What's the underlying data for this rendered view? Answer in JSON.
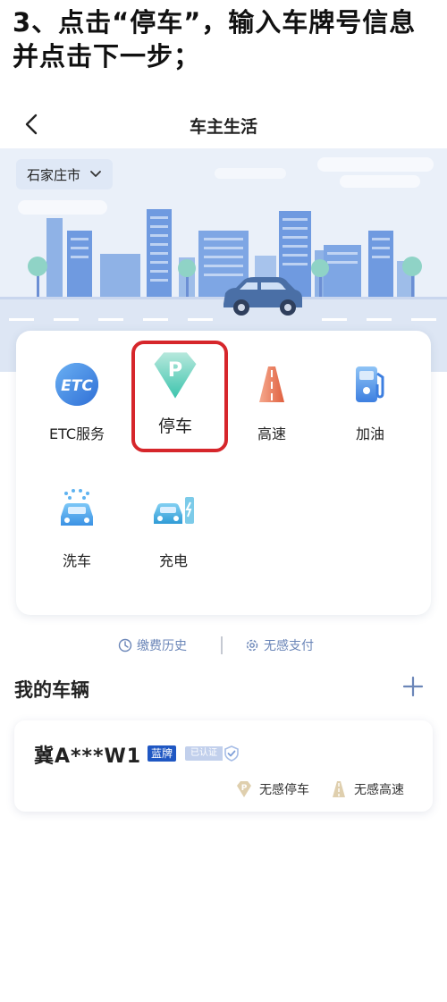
{
  "instruction": {
    "line1": "3、点击“停车”，输入车牌号信息",
    "line2": "并点击下一步；"
  },
  "nav": {
    "title": "车主生活",
    "back_icon": "chevron-left-icon"
  },
  "city": {
    "name": "石家庄市",
    "icon": "chevron-down-icon"
  },
  "services": [
    {
      "label": "ETC服务",
      "icon": "etc-icon"
    },
    {
      "label": "停车",
      "icon": "parking-icon",
      "highlighted": true
    },
    {
      "label": "高速",
      "icon": "highway-icon"
    },
    {
      "label": "加油",
      "icon": "fuel-icon"
    },
    {
      "label": "洗车",
      "icon": "car-wash-icon"
    },
    {
      "label": "充电",
      "icon": "charging-icon"
    }
  ],
  "links": {
    "history": "缴费历史",
    "pay": "无感支付"
  },
  "vehicles_title": "我的车辆",
  "vehicle": {
    "plate": "冀A***W1",
    "plate_color": "蓝牌",
    "verified": "已认证",
    "features": [
      "无感停车",
      "无感高速"
    ]
  },
  "colors": {
    "accent": "#6b86b8",
    "highlight_border": "#d6262b",
    "plate_blue": "#1f57c3"
  }
}
